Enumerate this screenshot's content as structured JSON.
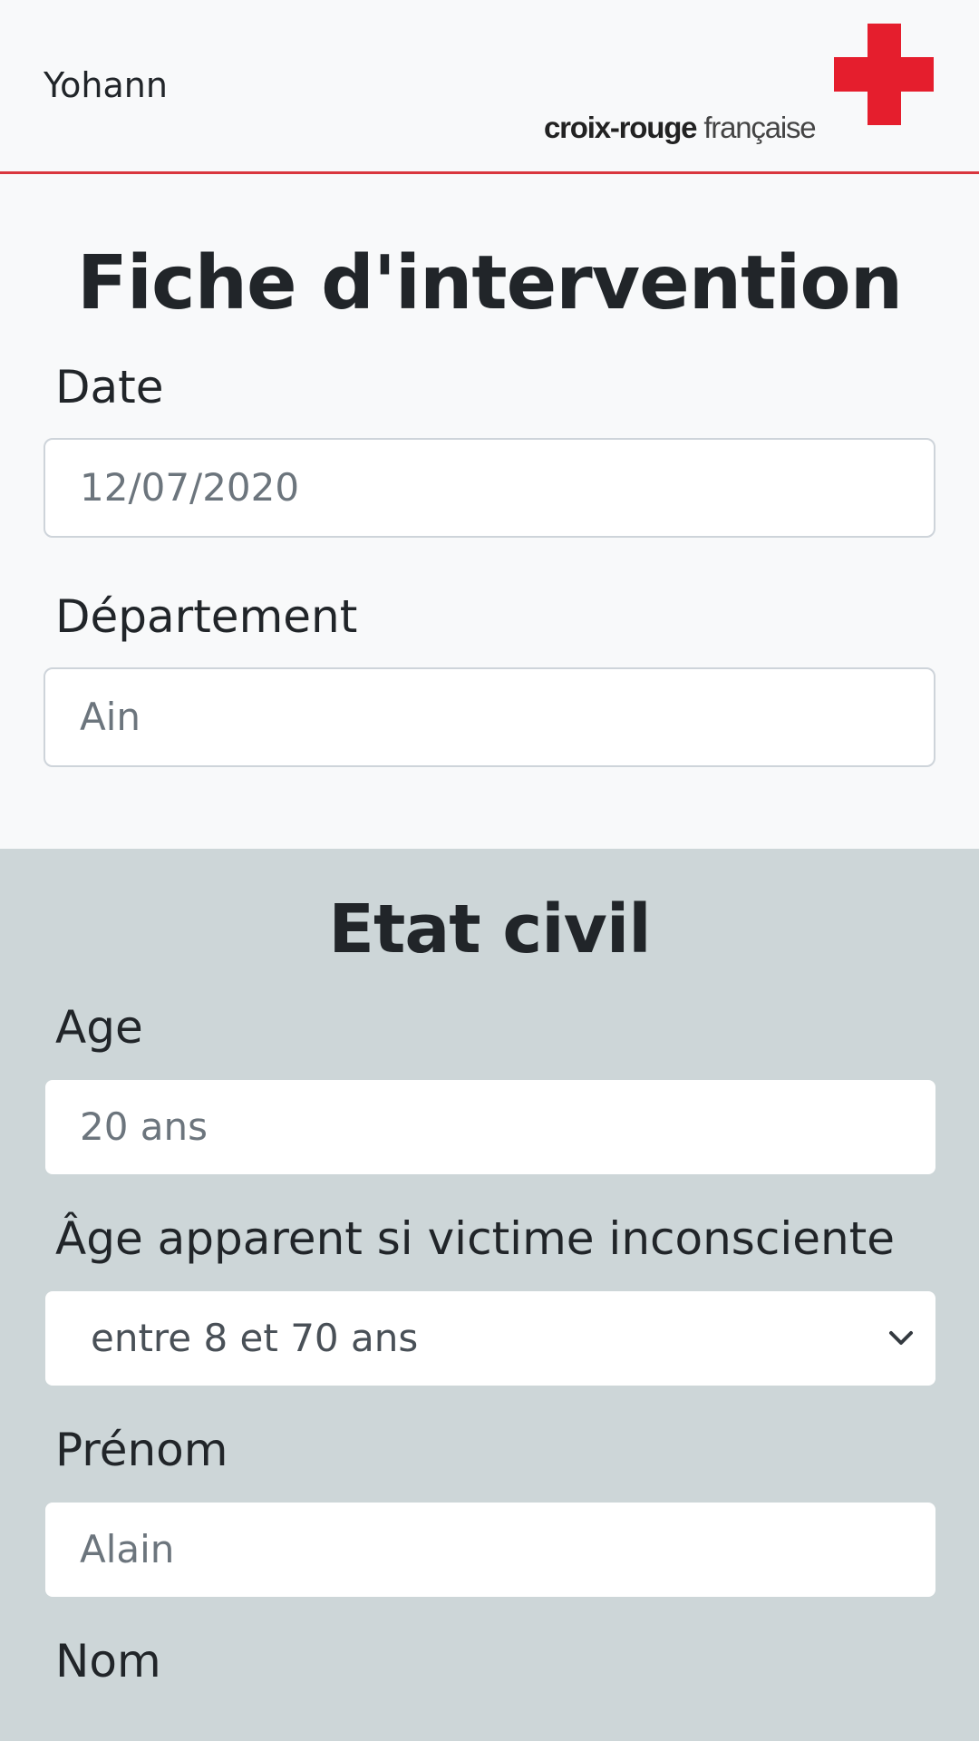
{
  "header": {
    "user_name": "Yohann",
    "logo": {
      "wordmark_bold": "croix-rouge",
      "wordmark_light": "française",
      "brand_color": "#e51e2d"
    },
    "divider_color": "#d9363e"
  },
  "intervention": {
    "title": "Fiche d'intervention",
    "date": {
      "label": "Date",
      "placeholder": "12/07/2020"
    },
    "departement": {
      "label": "Département",
      "placeholder": "Ain"
    }
  },
  "etat_civil": {
    "title": "Etat civil",
    "age": {
      "label": "Age",
      "placeholder": "20 ans"
    },
    "age_apparent": {
      "label": "Âge apparent si victime inconsciente",
      "selected": "entre 8 et 70 ans",
      "icon": "chevron-down-icon"
    },
    "prenom": {
      "label": "Prénom",
      "placeholder": "Alain"
    },
    "nom": {
      "label": "Nom"
    },
    "background_color": "#cdd6d8"
  }
}
